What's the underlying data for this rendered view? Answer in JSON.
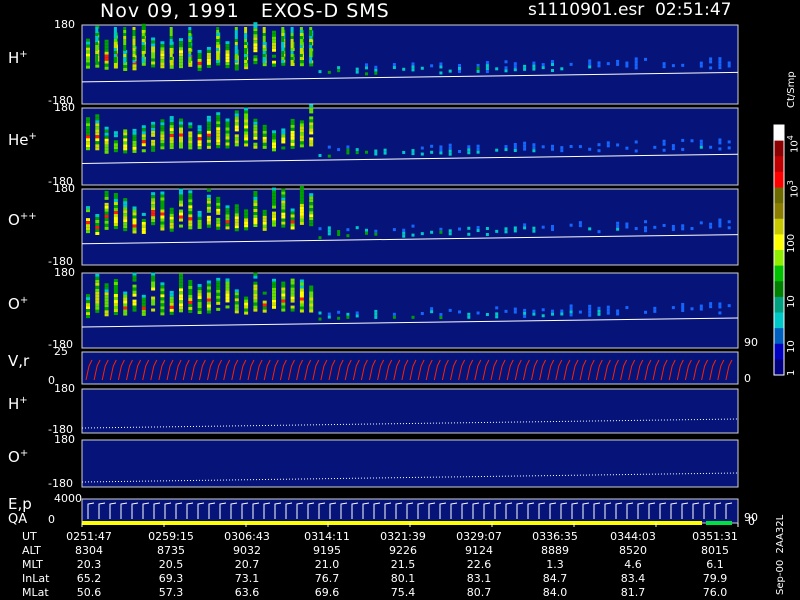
{
  "header": {
    "date": "Nov 09, 1991",
    "instrument": "EXOS-D SMS",
    "file": "s1110901.esr",
    "time": "02:51:47"
  },
  "colorbar": {
    "label": "Ct/Smp",
    "ticks": [
      "10",
      "10",
      "100",
      "10",
      "10",
      "1"
    ],
    "tick_exponents": [
      "4",
      "3",
      "",
      "",
      "",
      ""
    ],
    "colors": [
      "#ffffff",
      "#8b0000",
      "#c00000",
      "#ff0000",
      "#6b6b00",
      "#8b7d00",
      "#c8c800",
      "#ffff00",
      "#90ee00",
      "#00c000",
      "#008000",
      "#00a080",
      "#00c8c8",
      "#0060c0",
      "#0000c0",
      "#000080"
    ]
  },
  "panels": [
    {
      "label": "H",
      "sup": "+",
      "ymax": "180",
      "ymin": "-180"
    },
    {
      "label": "He",
      "sup": "+",
      "ymax": "180",
      "ymin": "-180"
    },
    {
      "label": "O",
      "sup": "++",
      "ymax": "180",
      "ymin": "-180"
    },
    {
      "label": "O",
      "sup": "+",
      "ymax": "180",
      "ymin": "-180",
      "right": "90"
    },
    {
      "label": "V,r",
      "sup": "",
      "ymax": "25",
      "ymin": "0",
      "right": "0"
    },
    {
      "label": "H",
      "sup": "+",
      "ymax": "180",
      "ymin": "-180"
    },
    {
      "label": "O",
      "sup": "+",
      "ymax": "180",
      "ymin": "-180"
    },
    {
      "label": "E,p",
      "sup": "",
      "ymax": "4000",
      "ymin": "0",
      "right": "90",
      "right2": "0"
    }
  ],
  "qa_label": "QA",
  "side_text": "Sep-00  2AA32L",
  "chart_data": {
    "type": "heatmap",
    "title": "Nov 09, 1991   EXOS-D SMS",
    "x_label": "UT",
    "rows": [
      {
        "name": "UT",
        "values": [
          "0251:47",
          "0259:15",
          "0306:43",
          "0314:11",
          "0321:39",
          "0329:07",
          "0336:35",
          "0344:03",
          "0351:31"
        ]
      },
      {
        "name": "ALT",
        "values": [
          "8304",
          "8735",
          "9032",
          "9195",
          "9226",
          "9124",
          "8889",
          "8520",
          "8015"
        ]
      },
      {
        "name": "MLT",
        "values": [
          "20.3",
          "20.5",
          "20.7",
          "21.0",
          "21.5",
          "22.6",
          "1.3",
          "4.6",
          "6.1"
        ]
      },
      {
        "name": "InLat",
        "values": [
          "65.2",
          "69.3",
          "73.1",
          "76.7",
          "80.1",
          "83.1",
          "84.7",
          "83.4",
          "79.9"
        ]
      },
      {
        "name": "MLat",
        "values": [
          "50.6",
          "57.3",
          "63.6",
          "69.6",
          "75.4",
          "80.7",
          "84.0",
          "81.7",
          "76.0"
        ]
      }
    ]
  }
}
